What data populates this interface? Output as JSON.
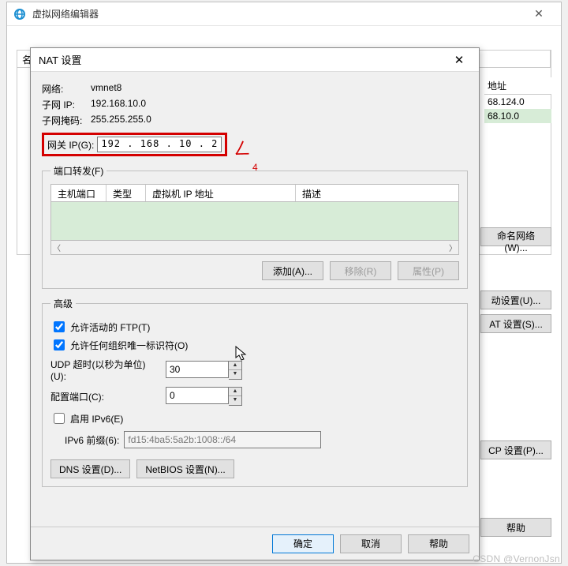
{
  "parent": {
    "title": "虚拟网络编辑器",
    "grid": {
      "col_name": "名",
      "col_addr": "地址"
    },
    "side_rows": [
      "68.124.0",
      "68.10.0"
    ],
    "buttons": {
      "rename": "命名网络(W)...",
      "auto": "动设置(U)...",
      "nat": "AT 设置(S)...",
      "dhcp": "CP 设置(P)..."
    },
    "help": "帮助"
  },
  "dialog": {
    "title": "NAT 设置",
    "network_lbl": "网络:",
    "network_val": "vmnet8",
    "subnet_lbl": "子网 IP:",
    "subnet_val": "192.168.10.0",
    "mask_lbl": "子网掩码:",
    "mask_val": "255.255.255.0",
    "gateway_lbl": "网关 IP(G):",
    "gateway_val": "192 . 168 . 10  .  2",
    "port_fwd": {
      "legend": "端口转发(F)",
      "col_host": "主机端口",
      "col_type": "类型",
      "col_vmip": "虚拟机 IP 地址",
      "col_desc": "描述",
      "add": "添加(A)...",
      "remove": "移除(R)",
      "props": "属性(P)"
    },
    "advanced": {
      "legend": "高级",
      "ftp": "允许活动的 FTP(T)",
      "oui": "允许任何组织唯一标识符(O)",
      "udp_lbl": "UDP 超时(以秒为单位)(U):",
      "udp_val": "30",
      "cfgport_lbl": "配置端口(C):",
      "cfgport_val": "0",
      "ipv6_enable": "启用 IPv6(E)",
      "ipv6_prefix_lbl": "IPv6 前缀(6):",
      "ipv6_prefix_val": "fd15:4ba5:5a2b:1008::/64",
      "dns": "DNS 设置(D)...",
      "netbios": "NetBIOS 设置(N)..."
    },
    "footer": {
      "ok": "确定",
      "cancel": "取消",
      "help": "帮助"
    }
  },
  "annotation": {
    "mark": "4"
  },
  "watermark": "CSDN @VernonJsn"
}
